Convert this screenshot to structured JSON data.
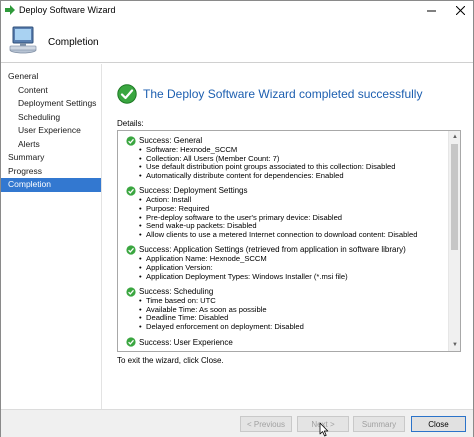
{
  "window": {
    "title": "Deploy Software Wizard",
    "accent_color": "#3378d0"
  },
  "header": {
    "title": "Completion",
    "icon": "computer-monitor-icon"
  },
  "sidebar": {
    "items": [
      {
        "label": "General",
        "level": "top"
      },
      {
        "label": "Content",
        "level": "sub"
      },
      {
        "label": "Deployment Settings",
        "level": "sub"
      },
      {
        "label": "Scheduling",
        "level": "sub"
      },
      {
        "label": "User Experience",
        "level": "sub"
      },
      {
        "label": "Alerts",
        "level": "sub"
      },
      {
        "label": "Summary",
        "level": "top"
      },
      {
        "label": "Progress",
        "level": "top"
      },
      {
        "label": "Completion",
        "level": "top",
        "active": true
      }
    ]
  },
  "main": {
    "headline": "The Deploy Software Wizard completed successfully",
    "headline_color": "#1d5fb0",
    "details_label": "Details:",
    "sections": [
      {
        "title": "Success: General",
        "items": [
          "Software: Hexnode_SCCM",
          "Collection: All Users (Member Count: 7)",
          "Use default distribution point groups associated to this collection: Disabled",
          "Automatically distribute content for dependencies: Enabled"
        ]
      },
      {
        "title": "Success: Deployment Settings",
        "items": [
          "Action: Install",
          "Purpose: Required",
          "Pre-deploy software to the user's primary device: Disabled",
          "Send wake-up packets: Disabled",
          "Allow clients to use a metered Internet connection to download content: Disabled"
        ]
      },
      {
        "title": "Success: Application Settings (retrieved from application in software library)",
        "items": [
          "Application Name: Hexnode_SCCM",
          "Application Version:",
          "Application Deployment Types: Windows Installer (*.msi file)"
        ]
      },
      {
        "title": "Success: Scheduling",
        "items": [
          "Time based on: UTC",
          "Available Time: As soon as possible",
          "Deadline Time: Disabled",
          "Delayed enforcement on deployment: Disabled"
        ]
      },
      {
        "title": "Success: User Experience",
        "items": []
      }
    ],
    "exit_text": "To exit the wizard, click Close."
  },
  "footer": {
    "previous_label": "< Previous",
    "next_label": "Next >",
    "summary_label": "Summary",
    "close_label": "Close"
  }
}
